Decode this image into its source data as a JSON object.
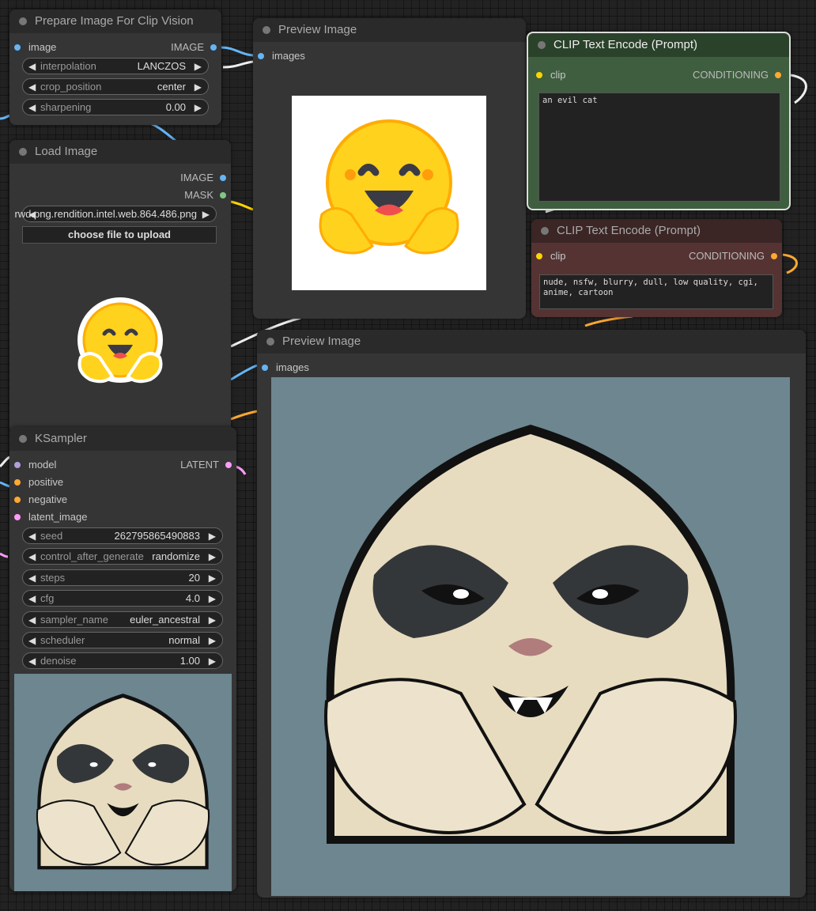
{
  "colors": {
    "canvas": "#222222",
    "node_bg": "#353535",
    "image_pin": "#64b5f6",
    "mask_pin": "#81c784",
    "clip_pin": "#ffd500",
    "conditioning_pin": "#ffa931",
    "latent_pin": "#ff9cf9",
    "model_pin": "#b39ddb",
    "positive_node": "#335533",
    "negative_node": "#553333"
  },
  "prepare_node": {
    "title": "Prepare Image For Clip Vision",
    "input": "image",
    "output": "IMAGE",
    "widgets": [
      {
        "label": "interpolation",
        "value": "LANCZOS"
      },
      {
        "label": "crop_position",
        "value": "center"
      },
      {
        "label": "sharpening",
        "value": "0.00"
      }
    ]
  },
  "preview1": {
    "title": "Preview Image",
    "input": "images"
  },
  "load_node": {
    "title": "Load Image",
    "outputs": [
      "IMAGE",
      "MASK"
    ],
    "image_value": "rwd.png.rendition.intel.web.864.486.png",
    "upload_label": "choose file to upload"
  },
  "clip_pos": {
    "title": "CLIP Text Encode (Prompt)",
    "input": "clip",
    "output": "CONDITIONING",
    "text": "an evil cat"
  },
  "clip_neg": {
    "title": "CLIP Text Encode (Prompt)",
    "input": "clip",
    "output": "CONDITIONING",
    "text": "nude, nsfw, blurry, dull, low quality, cgi, anime, cartoon"
  },
  "preview2": {
    "title": "Preview Image",
    "input": "images"
  },
  "ksampler": {
    "title": "KSampler",
    "inputs": [
      "model",
      "positive",
      "negative",
      "latent_image"
    ],
    "output": "LATENT",
    "widgets": [
      {
        "label": "seed",
        "value": "262795865490883"
      },
      {
        "label": "control_after_generate",
        "value": "randomize"
      },
      {
        "label": "steps",
        "value": "20"
      },
      {
        "label": "cfg",
        "value": "4.0"
      },
      {
        "label": "sampler_name",
        "value": "euler_ancestral"
      },
      {
        "label": "scheduler",
        "value": "normal"
      },
      {
        "label": "denoise",
        "value": "1.00"
      }
    ]
  }
}
